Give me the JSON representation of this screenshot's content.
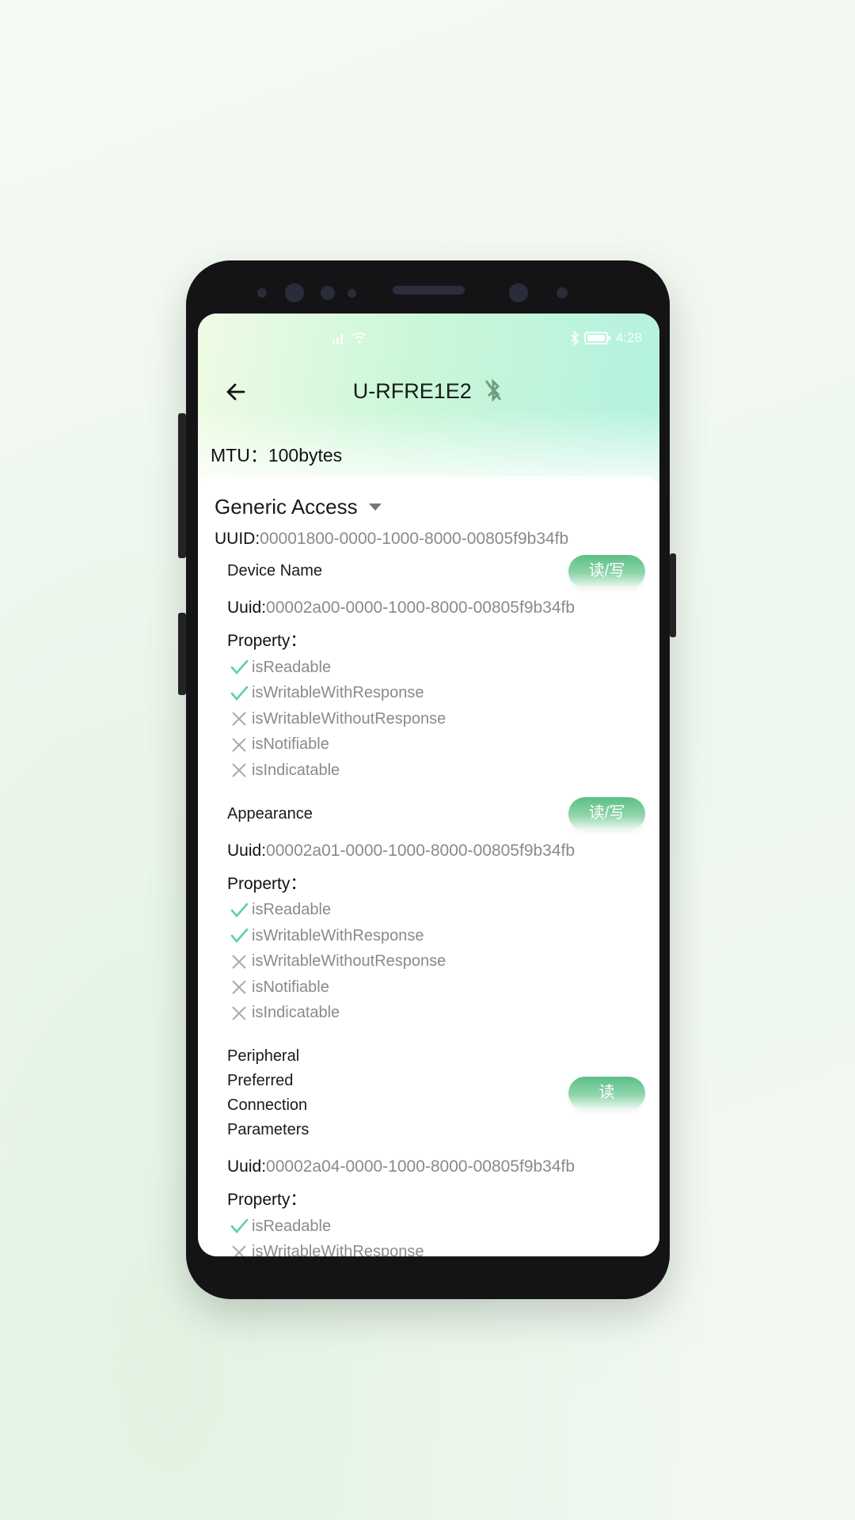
{
  "status_bar": {
    "time": "4:28",
    "icons": [
      "signal-icon",
      "wifi-icon",
      "bluetooth-icon",
      "battery-icon"
    ]
  },
  "header": {
    "title": "U-RFRE1E2",
    "back_icon": "arrow-left-icon",
    "status_icon": "bluetooth-disabled-icon"
  },
  "mtu": {
    "label": "MTU：",
    "value": "100bytes"
  },
  "service": {
    "name": "Generic Access",
    "uuid_label": "UUID:",
    "uuid": "00001800-0000-1000-8000-00805f9b34fb",
    "characteristics": [
      {
        "name": "Device Name",
        "button": "读/写",
        "uuid_label": "Uuid:",
        "uuid": "00002a00-0000-1000-8000-00805f9b34fb",
        "property_label": "Property：",
        "properties": [
          {
            "label": "isReadable",
            "enabled": true
          },
          {
            "label": "isWritableWithResponse",
            "enabled": true
          },
          {
            "label": "isWritableWithoutResponse",
            "enabled": false
          },
          {
            "label": "isNotifiable",
            "enabled": false
          },
          {
            "label": "isIndicatable",
            "enabled": false
          }
        ]
      },
      {
        "name": "Appearance",
        "button": "读/写",
        "uuid_label": "Uuid:",
        "uuid": "00002a01-0000-1000-8000-00805f9b34fb",
        "property_label": "Property：",
        "properties": [
          {
            "label": "isReadable",
            "enabled": true
          },
          {
            "label": "isWritableWithResponse",
            "enabled": true
          },
          {
            "label": "isWritableWithoutResponse",
            "enabled": false
          },
          {
            "label": "isNotifiable",
            "enabled": false
          },
          {
            "label": "isIndicatable",
            "enabled": false
          }
        ]
      },
      {
        "name": "Peripheral Preferred Connection Parameters",
        "button": "读",
        "uuid_label": "Uuid:",
        "uuid": "00002a04-0000-1000-8000-00805f9b34fb",
        "property_label": "Property：",
        "properties": [
          {
            "label": "isReadable",
            "enabled": true
          },
          {
            "label": "isWritableWithResponse",
            "enabled": false
          }
        ]
      }
    ]
  },
  "colors": {
    "accent": "#5cbf86",
    "check": "#5dd39b",
    "cross": "#aaaaaa"
  }
}
